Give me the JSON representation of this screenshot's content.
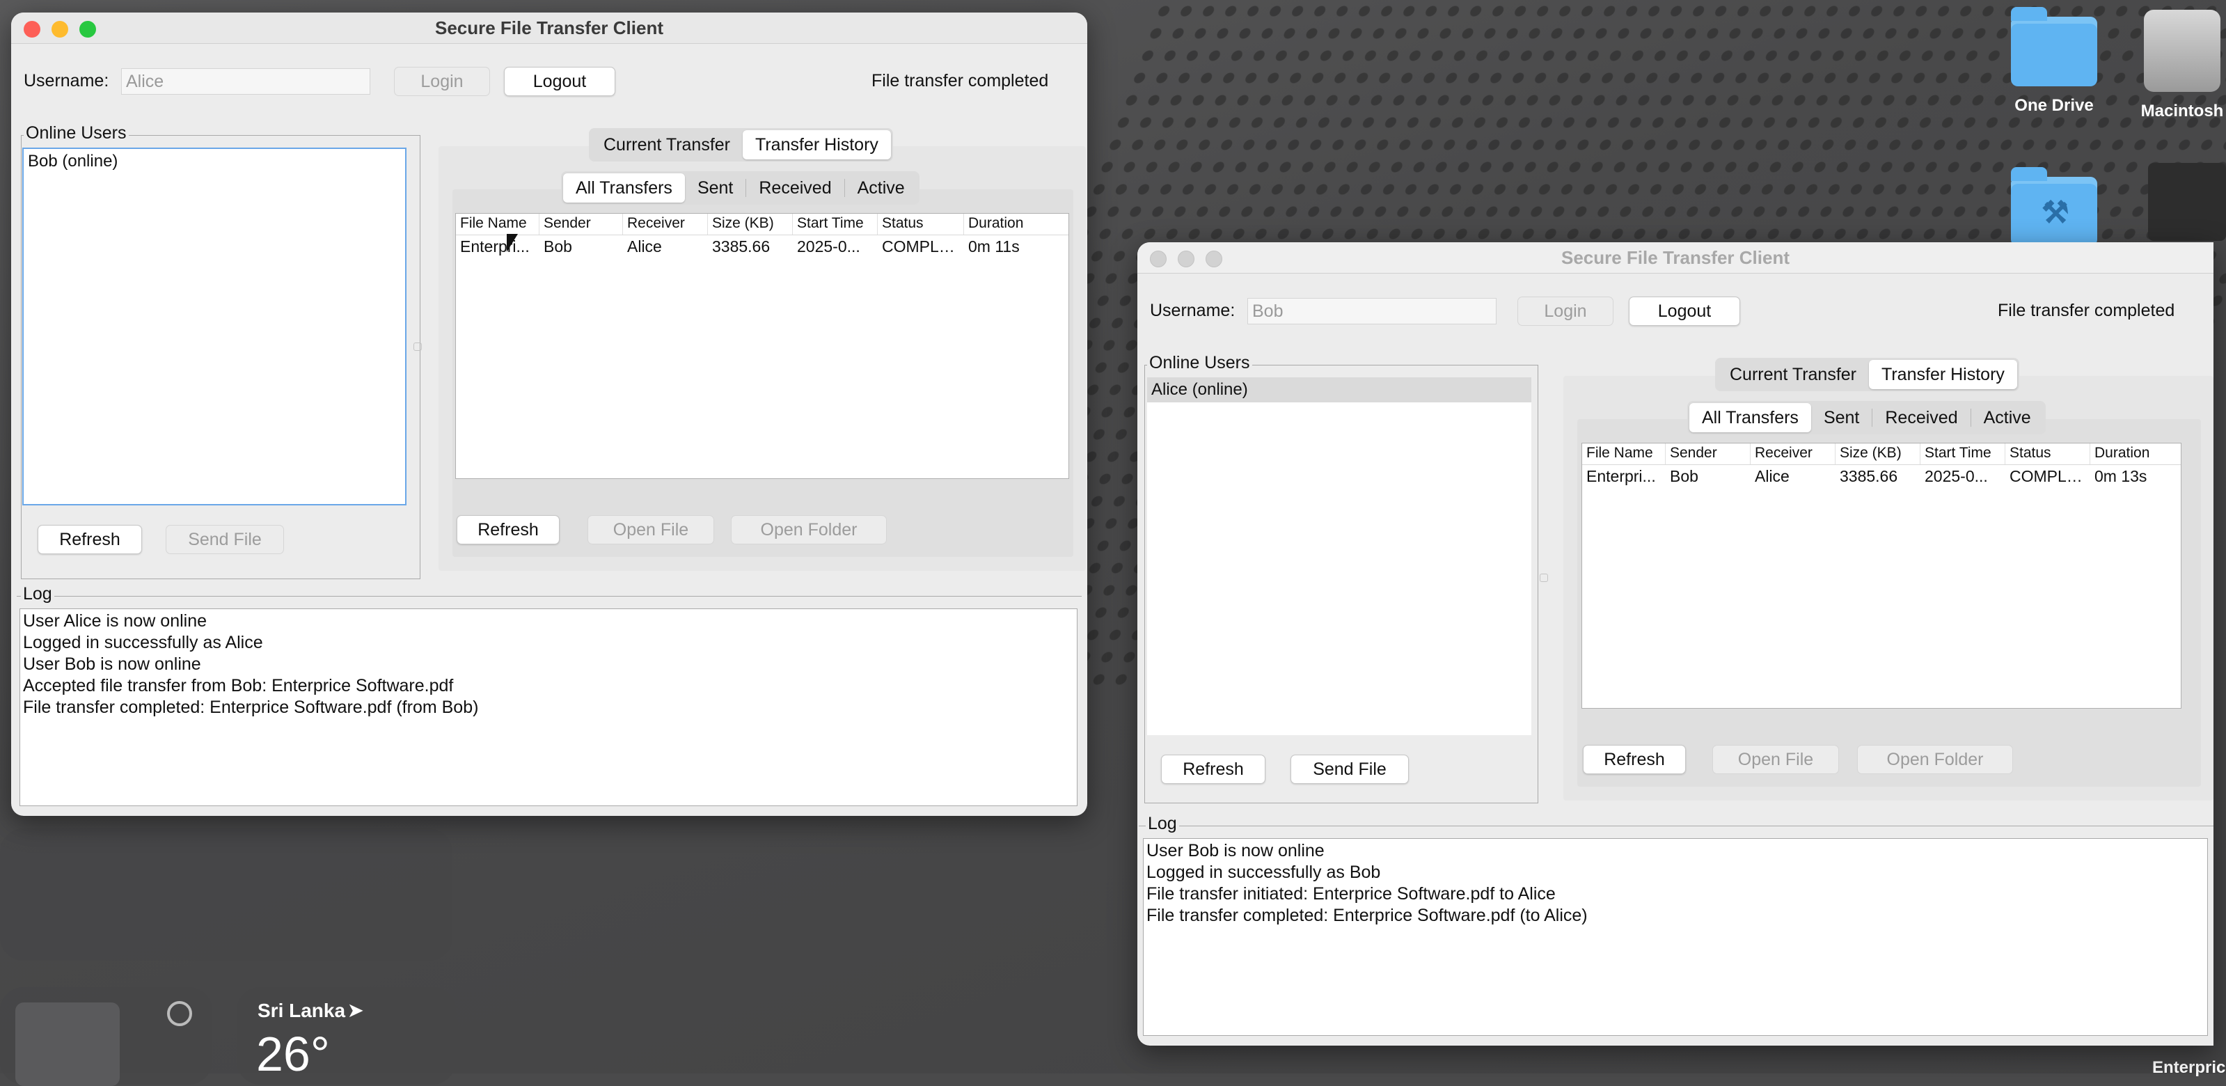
{
  "desktop": {
    "icons": [
      {
        "label": "One Drive"
      },
      {
        "label": "Macintosh"
      }
    ],
    "weather": {
      "location": "Sri Lanka",
      "temperature": "26°"
    },
    "edge_fragment": "Enterpric"
  },
  "alice_window": {
    "title": "Secure File Transfer Client",
    "username_label": "Username:",
    "username_value": "Alice",
    "login_label": "Login",
    "logout_label": "Logout",
    "status": "File transfer completed",
    "online_users_title": "Online Users",
    "online_users": [
      "Bob (online)"
    ],
    "refresh_label": "Refresh",
    "send_file_label": "Send File",
    "tabs": [
      "Current Transfer",
      "Transfer History"
    ],
    "filters": [
      "All Transfers",
      "Sent",
      "Received",
      "Active"
    ],
    "columns": [
      "File Name",
      "Sender",
      "Receiver",
      "Size (KB)",
      "Start Time",
      "Status",
      "Duration"
    ],
    "rows": [
      [
        "Enterpri...",
        "Bob",
        "Alice",
        "3385.66",
        "2025-0...",
        "COMPLE...",
        "0m 11s"
      ]
    ],
    "history_refresh_label": "Refresh",
    "open_file_label": "Open File",
    "open_folder_label": "Open Folder",
    "log_title": "Log",
    "log_lines": [
      "User Alice is now online",
      "Logged in successfully as Alice",
      "User Bob is now online",
      "Accepted file transfer from Bob: Enterprice Software.pdf",
      "File transfer completed: Enterprice Software.pdf (from Bob)"
    ]
  },
  "bob_window": {
    "title": "Secure File Transfer Client",
    "username_label": "Username:",
    "username_value": "Bob",
    "login_label": "Login",
    "logout_label": "Logout",
    "status": "File transfer completed",
    "online_users_title": "Online Users",
    "online_users": [
      "Alice (online)"
    ],
    "refresh_label": "Refresh",
    "send_file_label": "Send File",
    "tabs": [
      "Current Transfer",
      "Transfer History"
    ],
    "filters": [
      "All Transfers",
      "Sent",
      "Received",
      "Active"
    ],
    "columns": [
      "File Name",
      "Sender",
      "Receiver",
      "Size (KB)",
      "Start Time",
      "Status",
      "Duration"
    ],
    "rows": [
      [
        "Enterpri...",
        "Bob",
        "Alice",
        "3385.66",
        "2025-0...",
        "COMPLE...",
        "0m 13s"
      ]
    ],
    "history_refresh_label": "Refresh",
    "open_file_label": "Open File",
    "open_folder_label": "Open Folder",
    "log_title": "Log",
    "log_lines": [
      "User Bob is now online",
      "Logged in successfully as Bob",
      "File transfer initiated: Enterprice Software.pdf to Alice",
      "File transfer completed: Enterprice Software.pdf (to Alice)"
    ]
  }
}
